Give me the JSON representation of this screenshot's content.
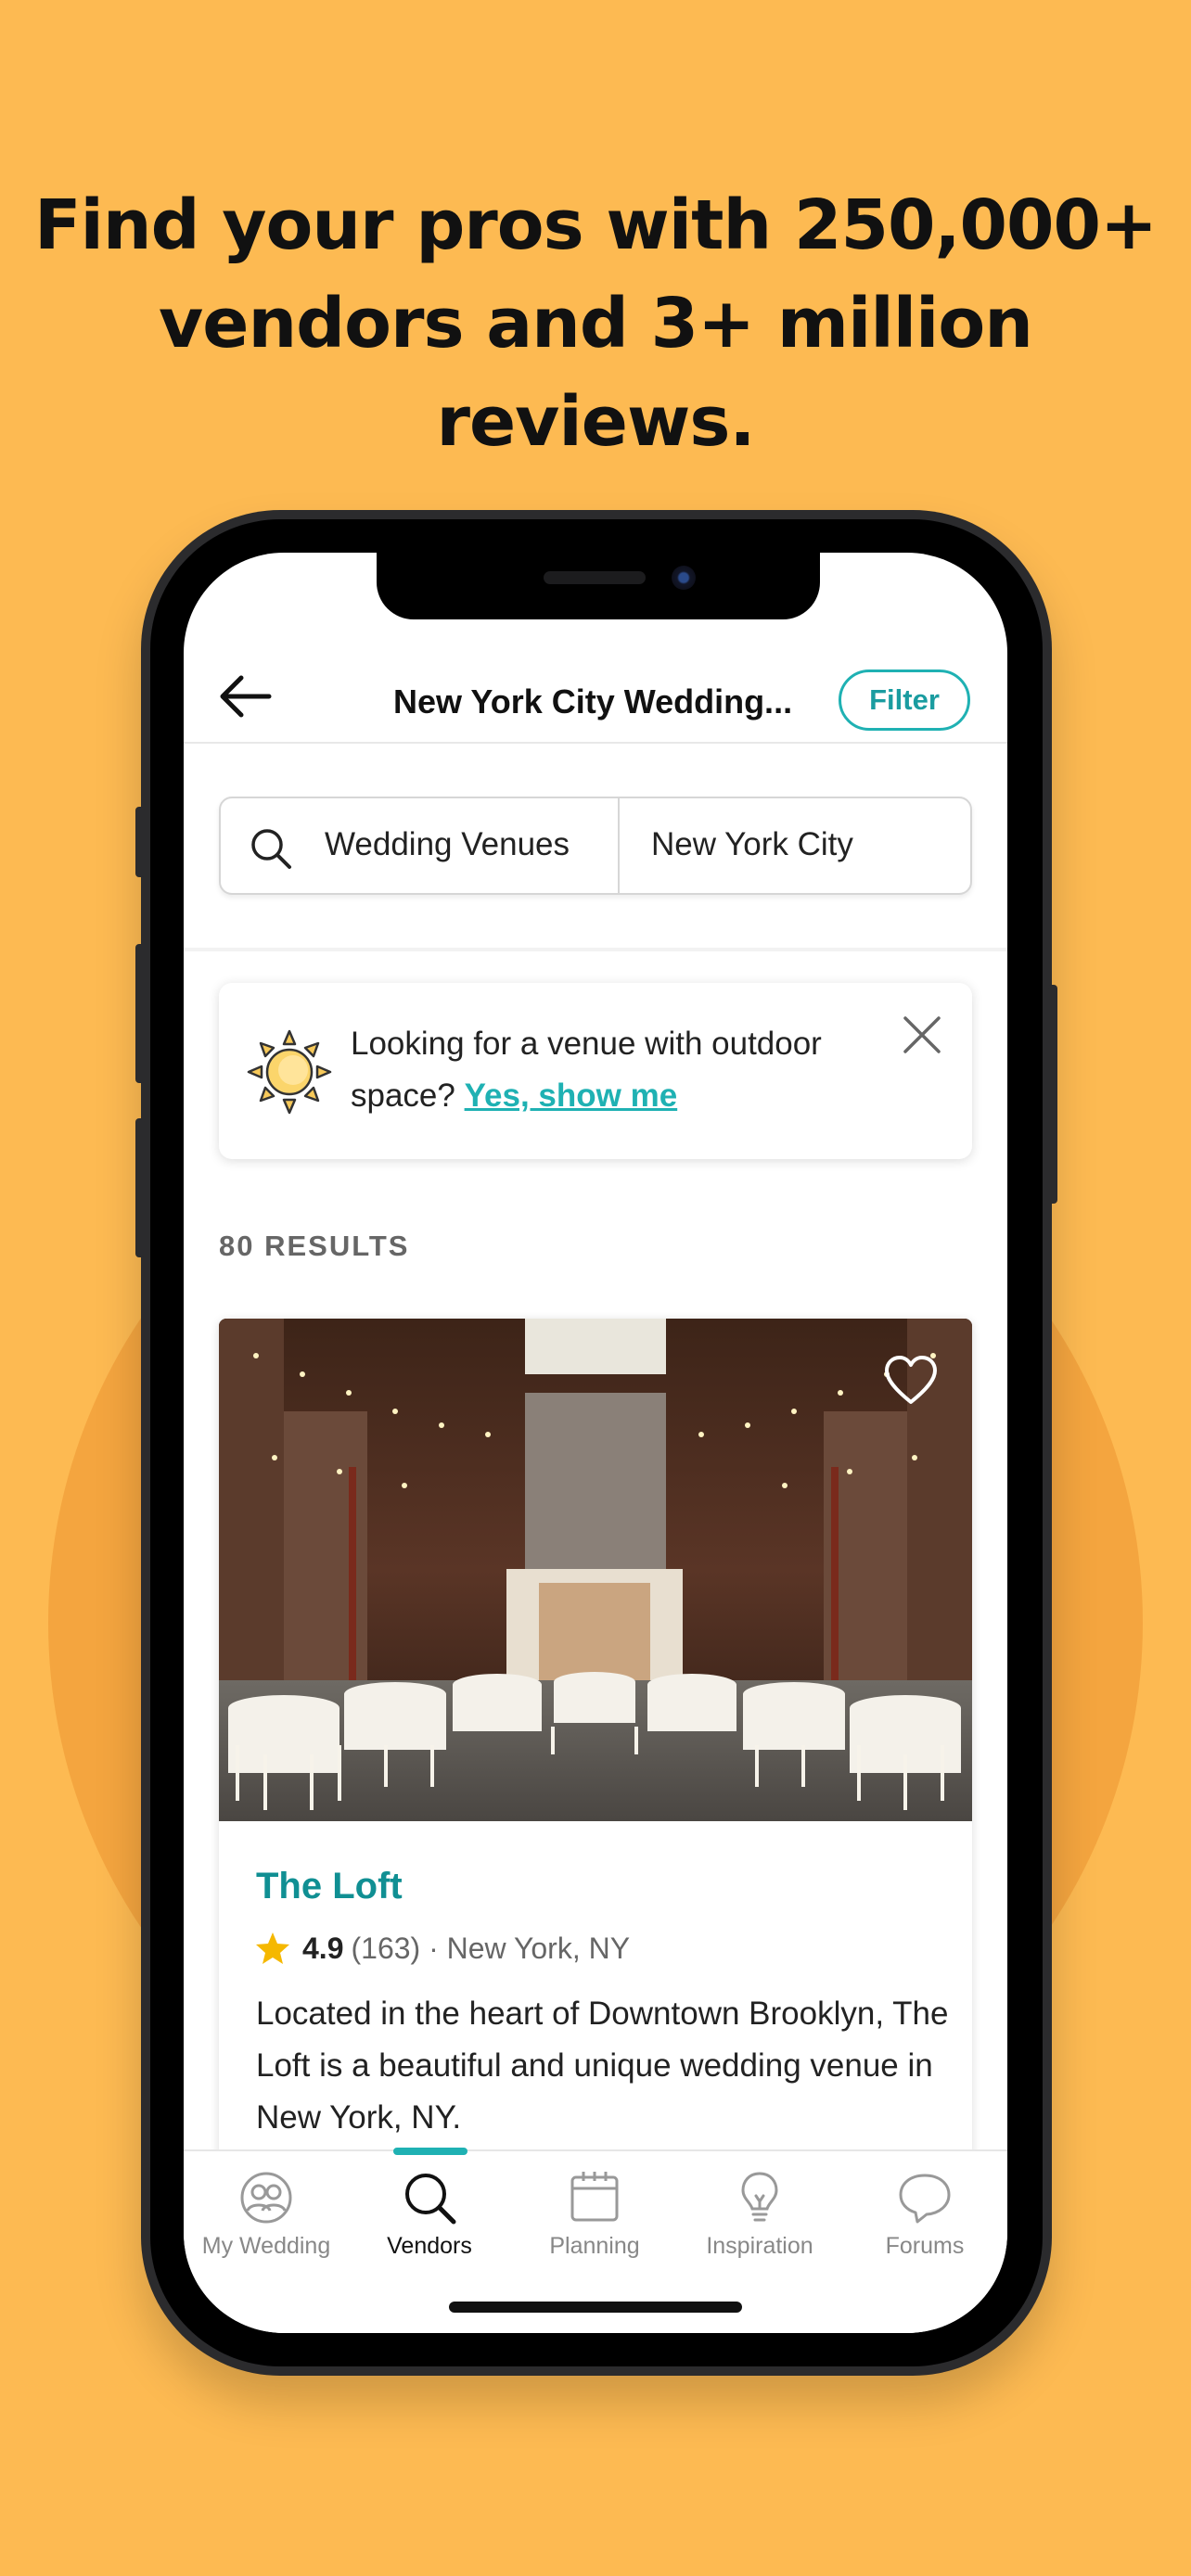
{
  "headline": {
    "line1": "Find your pros with 250,000+",
    "line2": "vendors and 3+ million reviews."
  },
  "colors": {
    "background": "#FDBA52",
    "accent": "#1fb1b3",
    "title_teal": "#108f93",
    "star": "#F5B800"
  },
  "header": {
    "back_icon": "arrow-left-icon",
    "title": "New York City Wedding...",
    "filter_label": "Filter"
  },
  "search": {
    "icon": "search-icon",
    "category": "Wedding Venues",
    "location": "New York City"
  },
  "promo": {
    "icon": "sun-icon",
    "text": "Looking for a venue with outdoor space?",
    "link": "Yes, show me",
    "close_icon": "close-icon"
  },
  "results": {
    "label": "80 RESULTS"
  },
  "listing": {
    "image": "barn-venue-photo",
    "favorite_icon": "heart-icon",
    "name": "The Loft",
    "rating": "4.9",
    "reviews": "(163)",
    "separator": " · ",
    "location": "New York, NY",
    "description": "Located in the heart of Downtown Brooklyn, The Loft is a beautiful and unique wedding venue in New York, NY."
  },
  "tabs": [
    {
      "label": "My Wedding",
      "icon": "couple-icon",
      "active": false
    },
    {
      "label": "Vendors",
      "icon": "search-icon",
      "active": true
    },
    {
      "label": "Planning",
      "icon": "calendar-icon",
      "active": false
    },
    {
      "label": "Inspiration",
      "icon": "lightbulb-icon",
      "active": false
    },
    {
      "label": "Forums",
      "icon": "chat-bubble-icon",
      "active": false
    }
  ]
}
